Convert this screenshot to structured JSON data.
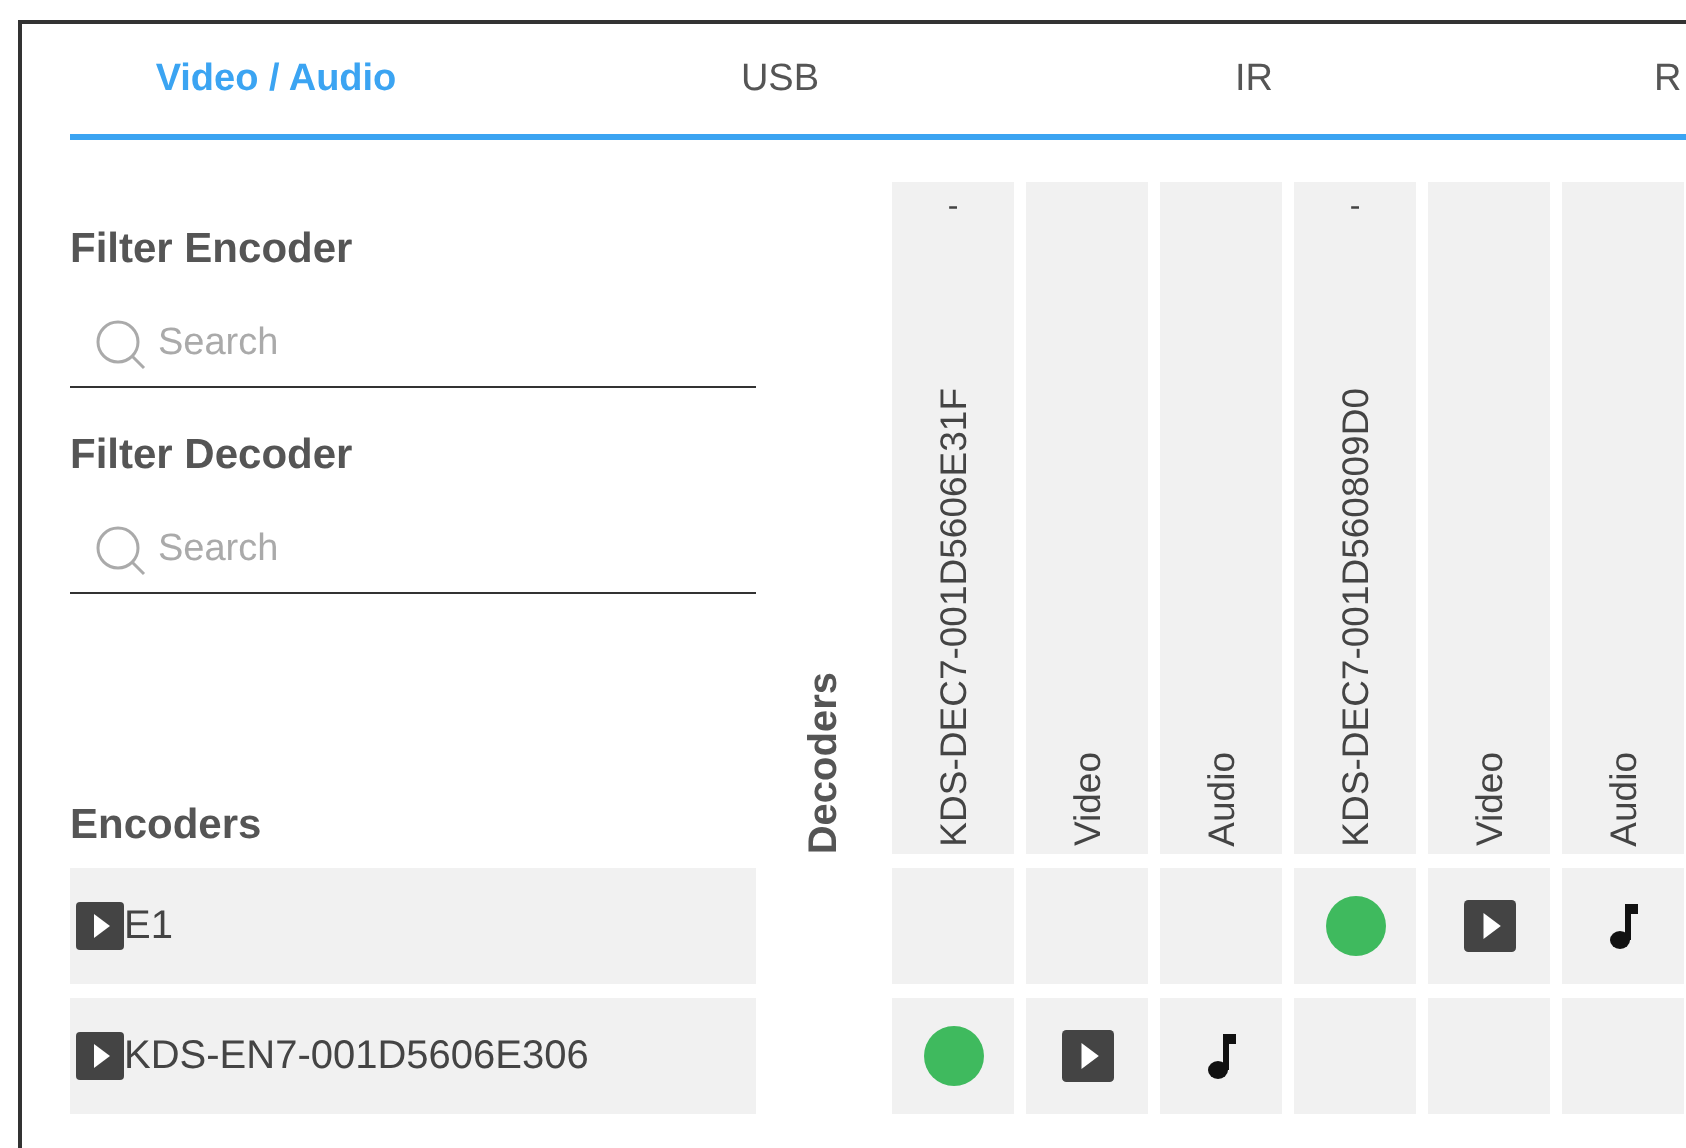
{
  "tabs": [
    {
      "label": "Video / Audio",
      "selected": true
    },
    {
      "label": "USB",
      "selected": false
    },
    {
      "label": "IR",
      "selected": false
    },
    {
      "label": "R",
      "selected": false
    }
  ],
  "filters": [
    {
      "label": "Filter Encoder",
      "placeholder": "Search"
    },
    {
      "label": "Filter Decoder",
      "placeholder": "Search"
    }
  ],
  "encoders_label": "Encoders",
  "decoders_label": "Decoders",
  "columns": [
    {
      "kind": "decoder",
      "label": "KDS-DEC7-001D5606E31F",
      "status": "-"
    },
    {
      "kind": "channel",
      "label": "Video"
    },
    {
      "kind": "channel",
      "label": "Audio"
    },
    {
      "kind": "decoder",
      "label": "KDS-DEC7-001D560809D0",
      "status": "-"
    },
    {
      "kind": "channel",
      "label": "Video"
    },
    {
      "kind": "channel",
      "label": "Audio"
    }
  ],
  "rows": [
    {
      "name": "E1",
      "cells": [
        {
          "kind": "empty"
        },
        {
          "kind": "empty"
        },
        {
          "kind": "empty"
        },
        {
          "kind": "connected"
        },
        {
          "kind": "video"
        },
        {
          "kind": "audio"
        }
      ]
    },
    {
      "name": "KDS-EN7-001D5606E306",
      "cells": [
        {
          "kind": "connected"
        },
        {
          "kind": "video"
        },
        {
          "kind": "audio"
        },
        {
          "kind": "empty"
        },
        {
          "kind": "empty"
        },
        {
          "kind": "empty"
        }
      ]
    }
  ]
}
